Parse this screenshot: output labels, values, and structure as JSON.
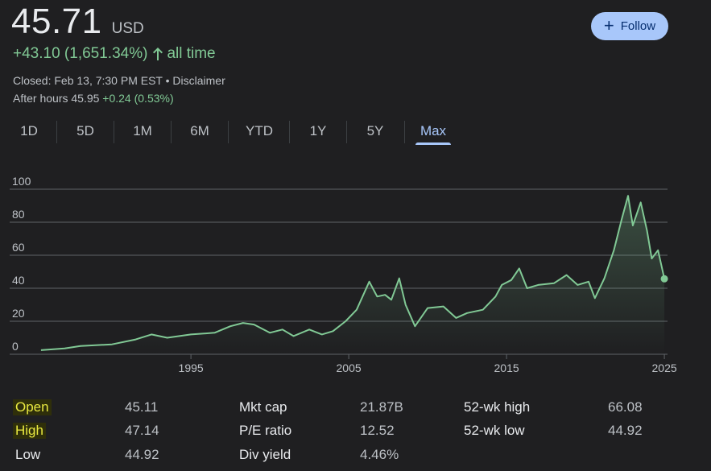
{
  "quote": {
    "price": "45.71",
    "currency": "USD",
    "change": "+43.10 (1,651.34%)",
    "period": "all time",
    "closed": "Closed: Feb 13, 7:30 PM EST",
    "separator": " • ",
    "disclaimer": "Disclaimer",
    "after_hours_label": "After hours 45.95",
    "after_hours_change": "+0.24 (0.53%)"
  },
  "follow": {
    "label": "Follow",
    "icon": "plus-icon"
  },
  "tabs": [
    {
      "label": "1D"
    },
    {
      "label": "5D"
    },
    {
      "label": "1M"
    },
    {
      "label": "6M"
    },
    {
      "label": "YTD"
    },
    {
      "label": "1Y"
    },
    {
      "label": "5Y"
    },
    {
      "label": "Max",
      "active": true
    }
  ],
  "colors": {
    "accent": "#a8c7fa",
    "positive": "#81c995",
    "line": "#81c995"
  },
  "chart_data": {
    "type": "area",
    "x_ticks": [
      "1995",
      "2005",
      "2015",
      "2025"
    ],
    "y_ticks": [
      "0",
      "20",
      "40",
      "60",
      "80",
      "100"
    ],
    "ylim": [
      0,
      100
    ],
    "xlim": [
      1985.3,
      2025.2
    ],
    "grid": true,
    "series": [
      {
        "x": [
          1985.5,
          1987,
          1988,
          1990,
          1991.5,
          1992.5,
          1993.5,
          1995,
          1996.5,
          1997.5,
          1998.3,
          1999,
          2000,
          2000.8,
          2001.5,
          2002.5,
          2003.3,
          2004,
          2004.8,
          2005.5,
          2006.3,
          2006.8,
          2007.3,
          2007.7,
          2008.2,
          2008.6,
          2009.2,
          2010,
          2011,
          2011.8,
          2012.5,
          2013.5,
          2014.3,
          2014.7,
          2015.3,
          2015.8,
          2016.3,
          2017,
          2018,
          2018.8,
          2019.5,
          2020.2,
          2020.6,
          2021.2,
          2021.8,
          2022.3,
          2022.7,
          2023,
          2023.5,
          2023.9,
          2024.2,
          2024.6,
          2025.0
        ],
        "y": [
          2.5,
          3.5,
          5,
          6,
          9,
          12,
          10,
          12,
          13,
          17,
          19,
          18,
          13,
          15,
          11,
          15,
          12,
          14,
          20,
          27,
          44,
          35,
          36,
          33,
          46,
          30,
          17,
          28,
          29,
          22,
          25,
          27,
          35,
          42,
          45,
          52,
          40,
          42,
          43,
          48,
          42,
          44,
          34,
          46,
          63,
          82,
          96,
          78,
          92,
          75,
          58,
          63,
          45.71
        ]
      }
    ]
  },
  "stats": {
    "col1": [
      {
        "label": "Open",
        "value": "45.11"
      },
      {
        "label": "High",
        "value": "47.14"
      },
      {
        "label": "Low",
        "value": "44.92"
      }
    ],
    "col2": [
      {
        "label": "Mkt cap",
        "value": "21.87B"
      },
      {
        "label": "P/E ratio",
        "value": "12.52"
      },
      {
        "label": "Div yield",
        "value": "4.46%"
      }
    ],
    "col3": [
      {
        "label": "52-wk high",
        "value": "66.08"
      },
      {
        "label": "52-wk low",
        "value": "44.92"
      }
    ]
  }
}
